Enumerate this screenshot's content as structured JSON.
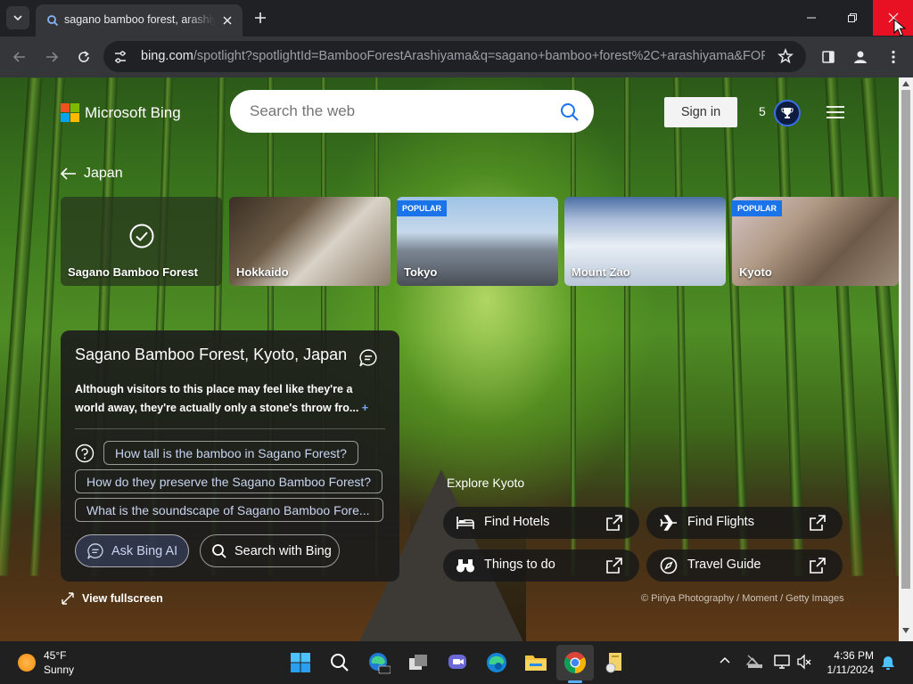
{
  "browser": {
    "tab_title": "sagano bamboo forest, arashiyama",
    "url_host": "bing.com",
    "url_rest": "/spotlight?spotlightId=BambooForestArashiyama&q=sagano+bamboo+forest%2C+arashiyama&FOR..."
  },
  "header": {
    "logo_text": "Microsoft Bing",
    "search_placeholder": "Search the web",
    "sign_in_label": "Sign in",
    "reward_count": "5"
  },
  "nav": {
    "back_label": "Japan"
  },
  "carousel": [
    {
      "label": "Sagano Bamboo Forest",
      "badge": "",
      "selected": true
    },
    {
      "label": "Hokkaido",
      "badge": ""
    },
    {
      "label": "Tokyo",
      "badge": "POPULAR"
    },
    {
      "label": "Mount Zao",
      "badge": ""
    },
    {
      "label": "Kyoto",
      "badge": "POPULAR"
    }
  ],
  "info": {
    "title": "Sagano Bamboo Forest, Kyoto, Japan",
    "description": "Although visitors to this place may feel like they're a world away, they're actually only a stone's throw fro...",
    "more_symbol": "+",
    "questions": [
      "How tall is the bamboo in Sagano Forest?",
      "How do they preserve the Sagano Bamboo Forest?",
      "What is the soundscape of Sagano Bamboo Fore..."
    ],
    "ask_ai_label": "Ask Bing AI",
    "search_label": "Search with Bing"
  },
  "fullscreen_label": "View fullscreen",
  "explore": {
    "title": "Explore Kyoto",
    "buttons": [
      {
        "label": "Find Hotels",
        "icon": "bed-icon"
      },
      {
        "label": "Find Flights",
        "icon": "plane-icon"
      },
      {
        "label": "Things to do",
        "icon": "binoculars-icon"
      },
      {
        "label": "Travel Guide",
        "icon": "compass-icon"
      }
    ]
  },
  "credit": "© Piriya Photography / Moment / Getty Images",
  "taskbar": {
    "temperature": "45°F",
    "condition": "Sunny",
    "time": "4:36 PM",
    "date": "1/11/2024"
  },
  "colors": {
    "accent_blue": "#1a73e8",
    "close_red": "#e81123",
    "badge_blue": "#1a73e8"
  }
}
